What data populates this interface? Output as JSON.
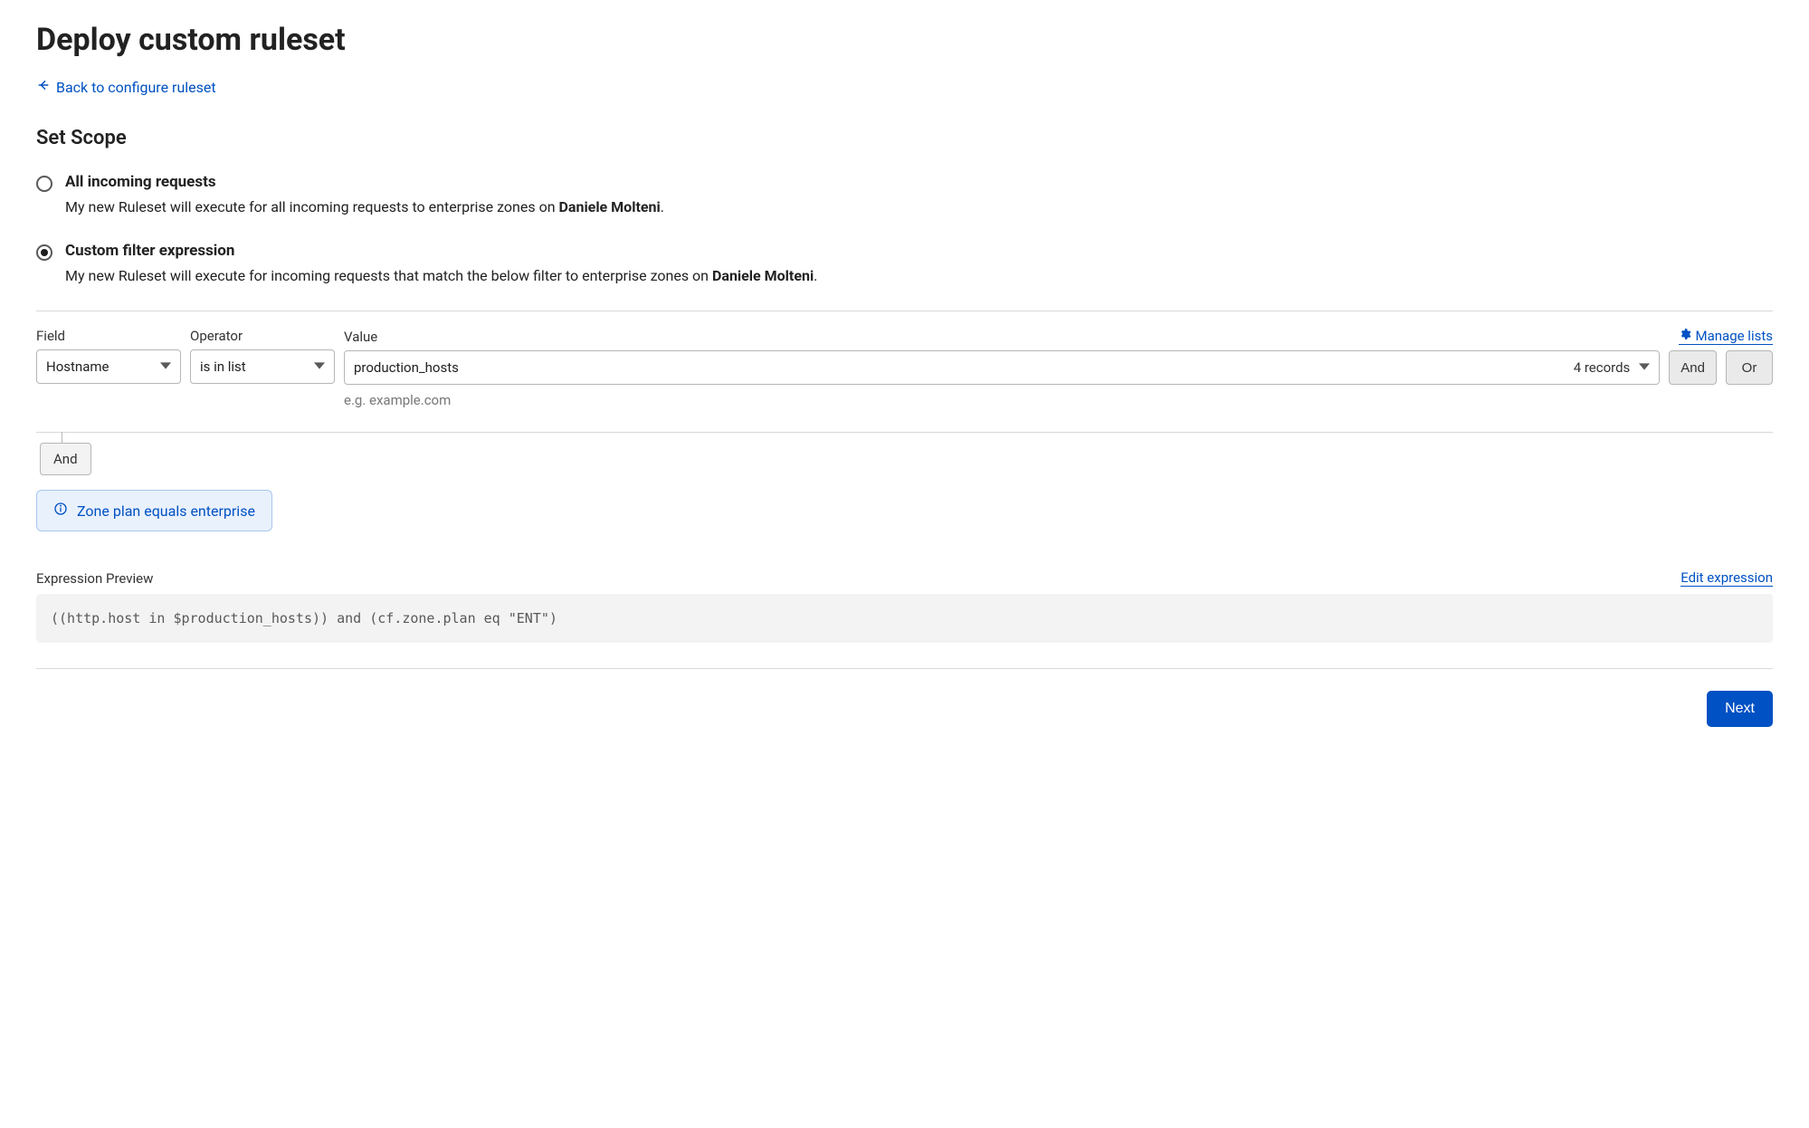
{
  "page": {
    "title": "Deploy custom ruleset",
    "back_label": "Back to configure ruleset",
    "section_title": "Set Scope"
  },
  "scope": {
    "options": [
      {
        "label": "All incoming requests",
        "desc_prefix": "My new Ruleset will execute for all incoming requests to enterprise zones on ",
        "desc_bold": "Daniele Molteni",
        "desc_suffix": ".",
        "checked": false
      },
      {
        "label": "Custom filter expression",
        "desc_prefix": "My new Ruleset will execute for incoming requests that match the below filter to enterprise zones on ",
        "desc_bold": "Daniele Molteni",
        "desc_suffix": ".",
        "checked": true
      }
    ]
  },
  "filter": {
    "headers": {
      "field": "Field",
      "operator": "Operator",
      "value": "Value"
    },
    "manage_lists": "Manage lists",
    "field_value": "Hostname",
    "operator_value": "is in list",
    "value_value": "production_hosts",
    "records_label": "4 records",
    "hint": "e.g. example.com",
    "and_label": "And",
    "or_label": "Or",
    "connector_label": "And",
    "fixed_condition": "Zone plan equals enterprise"
  },
  "preview": {
    "label": "Expression Preview",
    "edit_label": "Edit expression",
    "expression": "((http.host in $production_hosts)) and (cf.zone.plan eq \"ENT\")"
  },
  "footer": {
    "next_label": "Next"
  }
}
